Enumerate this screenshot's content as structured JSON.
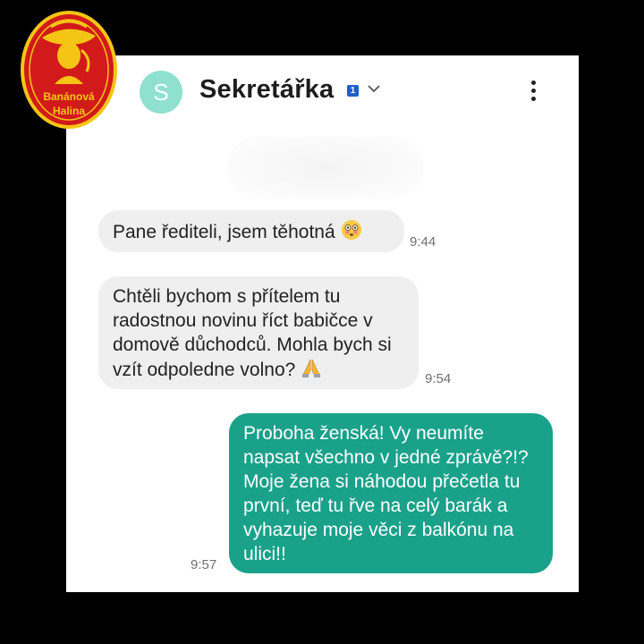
{
  "header": {
    "contact_name": "Sekretářka",
    "avatar_letter": "S",
    "sim_badge": "1"
  },
  "messages": [
    {
      "direction": "incoming",
      "text": "Pane řediteli, jsem těhotná",
      "emoji": "flushed-face",
      "time": "9:44"
    },
    {
      "direction": "incoming",
      "text": "Chtěli bychom s přítelem tu radostnou novinu říct babičce v domově důchodců. Mohla bych si vzít odpoledne volno?",
      "emoji": "folded-hands",
      "time": "9:54"
    },
    {
      "direction": "outgoing",
      "text": "Proboha ženská! Vy neumíte napsat všechno v jedné zprávě?!? Moje žena si náhodou přečetla tu první, teď tu řve na celý barák a vyhazuje moje věci z balkónu na ulici!!",
      "time": "9:57"
    }
  ],
  "watermark": {
    "line1": "Banánová",
    "line2": "Halina"
  },
  "colors": {
    "outgoing_bubble": "#1aa18a",
    "incoming_bubble": "#efefef",
    "avatar": "#8fe0cf",
    "logo_red": "#d21a1a",
    "logo_gold": "#f5c516"
  }
}
